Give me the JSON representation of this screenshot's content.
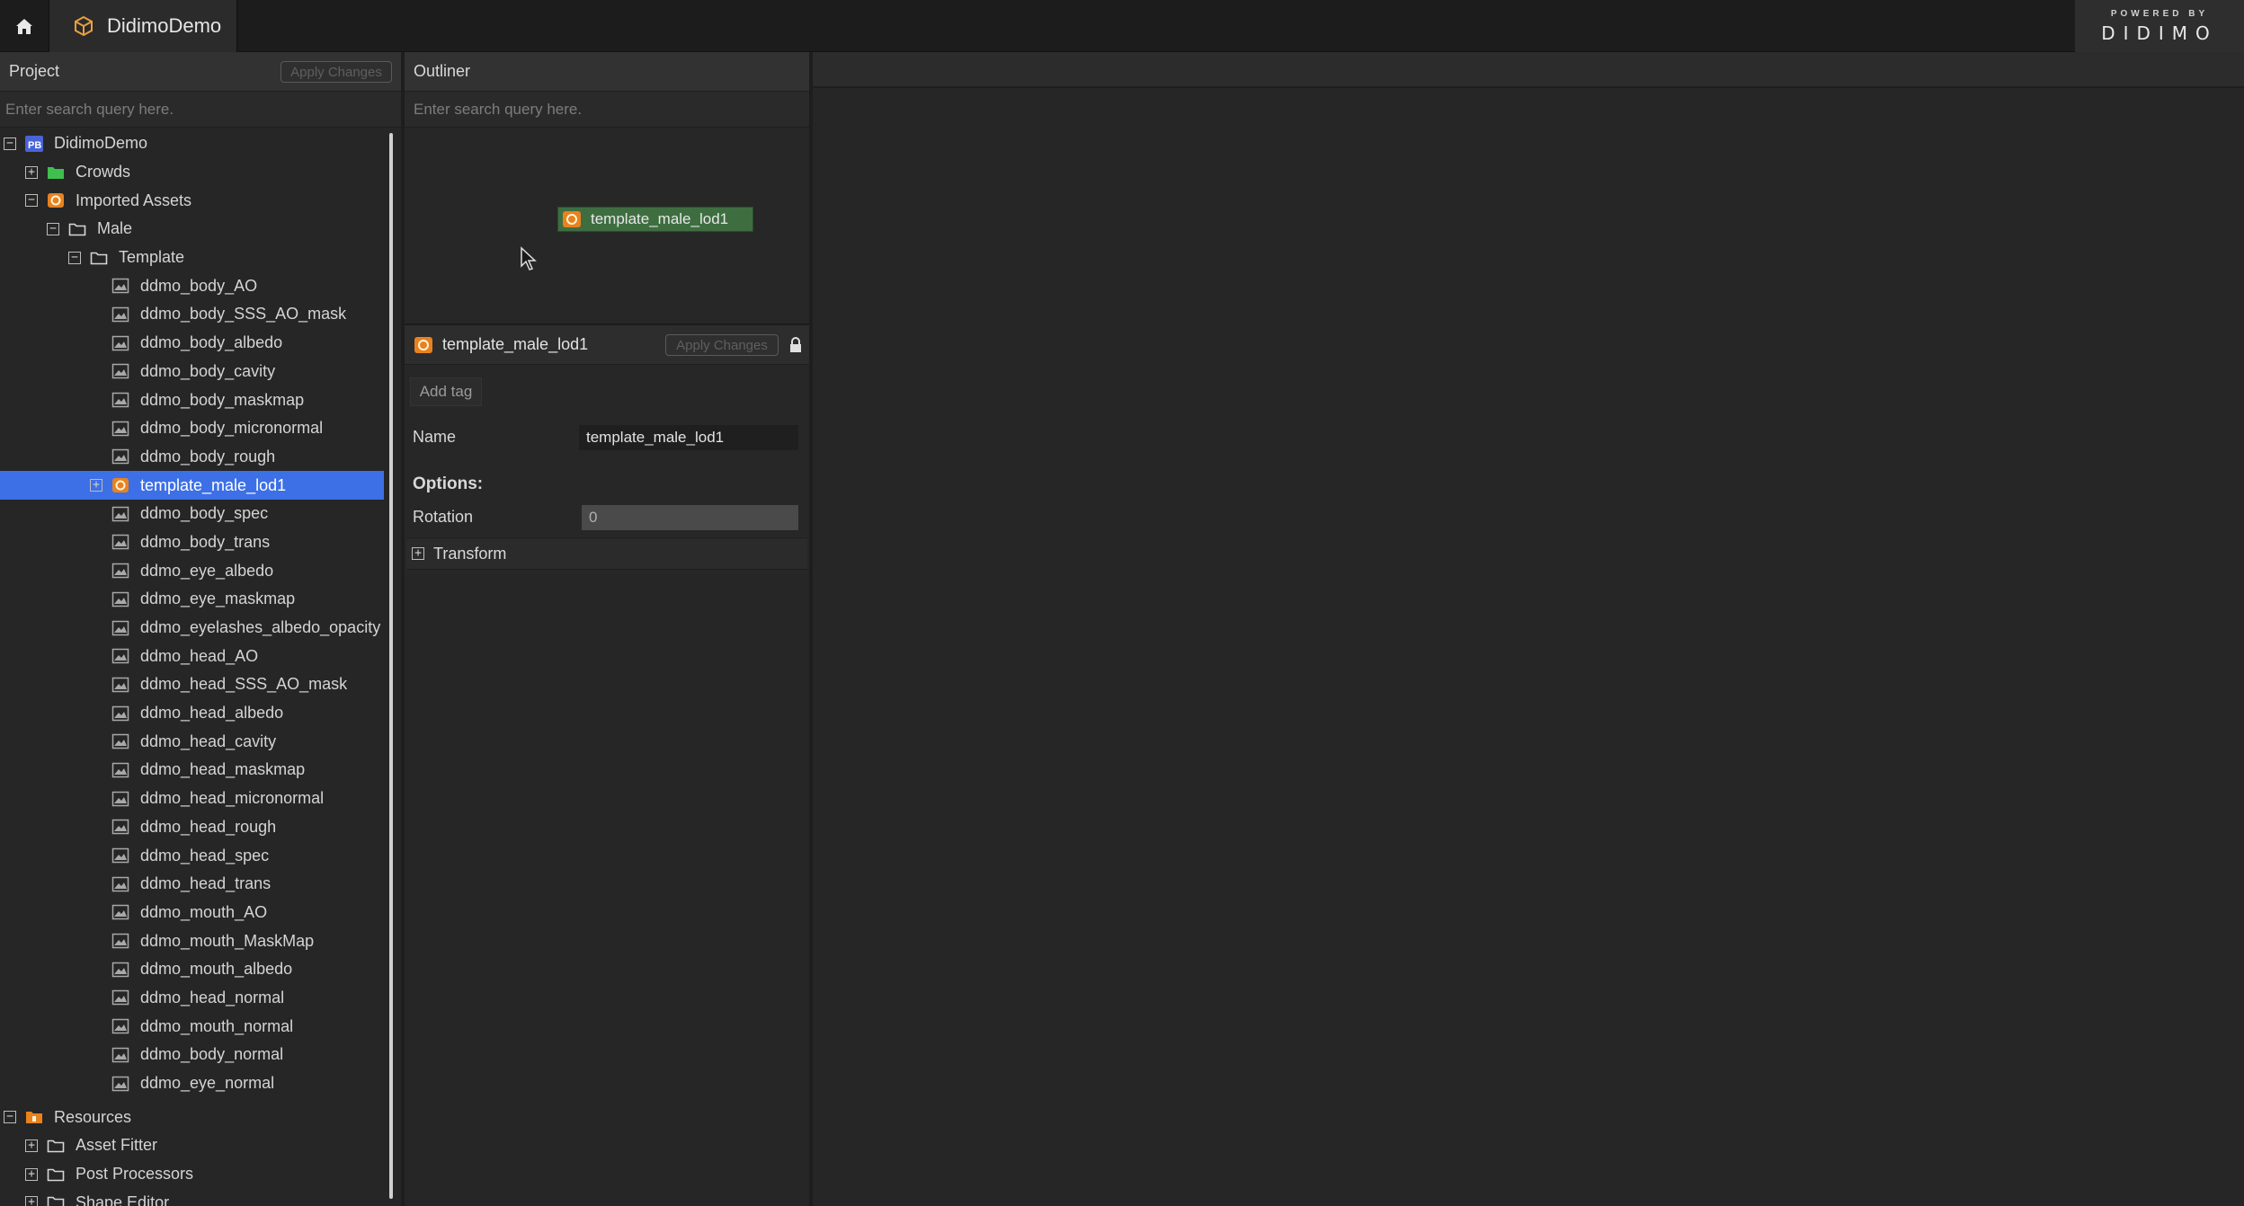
{
  "topbar": {
    "tab_title": "DidimoDemo",
    "brand_powered": "POWERED BY",
    "brand_logo": "DIDIMO"
  },
  "project": {
    "title": "Project",
    "apply_label": "Apply Changes",
    "search_placeholder": "Enter search query here.",
    "tree": [
      {
        "label": "DidimoDemo",
        "level": 0,
        "toggle": "minus",
        "icon": "project-icon"
      },
      {
        "label": "Crowds",
        "level": 1,
        "toggle": "plus",
        "icon": "green-folder-icon"
      },
      {
        "label": "Imported Assets",
        "level": 1,
        "toggle": "minus",
        "icon": "orange-asset-icon"
      },
      {
        "label": "Male",
        "level": 2,
        "toggle": "minus",
        "icon": "folder-icon"
      },
      {
        "label": "Template",
        "level": 3,
        "toggle": "minus",
        "icon": "folder-icon"
      },
      {
        "label": "ddmo_body_AO",
        "level": 4,
        "toggle": "none",
        "icon": "texture-icon"
      },
      {
        "label": "ddmo_body_SSS_AO_mask",
        "level": 4,
        "toggle": "none",
        "icon": "texture-icon"
      },
      {
        "label": "ddmo_body_albedo",
        "level": 4,
        "toggle": "none",
        "icon": "texture-icon"
      },
      {
        "label": "ddmo_body_cavity",
        "level": 4,
        "toggle": "none",
        "icon": "texture-icon"
      },
      {
        "label": "ddmo_body_maskmap",
        "level": 4,
        "toggle": "none",
        "icon": "texture-icon"
      },
      {
        "label": "ddmo_body_micronormal",
        "level": 4,
        "toggle": "none",
        "icon": "texture-icon"
      },
      {
        "label": "ddmo_body_rough",
        "level": 4,
        "toggle": "none",
        "icon": "texture-icon"
      },
      {
        "label": "template_male_lod1",
        "level": 4,
        "toggle": "plus",
        "icon": "orange-asset-icon",
        "selected": true
      },
      {
        "label": "ddmo_body_spec",
        "level": 4,
        "toggle": "none",
        "icon": "texture-icon"
      },
      {
        "label": "ddmo_body_trans",
        "level": 4,
        "toggle": "none",
        "icon": "texture-icon"
      },
      {
        "label": "ddmo_eye_albedo",
        "level": 4,
        "toggle": "none",
        "icon": "texture-icon"
      },
      {
        "label": "ddmo_eye_maskmap",
        "level": 4,
        "toggle": "none",
        "icon": "texture-icon"
      },
      {
        "label": "ddmo_eyelashes_albedo_opacity",
        "level": 4,
        "toggle": "none",
        "icon": "texture-icon"
      },
      {
        "label": "ddmo_head_AO",
        "level": 4,
        "toggle": "none",
        "icon": "texture-icon"
      },
      {
        "label": "ddmo_head_SSS_AO_mask",
        "level": 4,
        "toggle": "none",
        "icon": "texture-icon"
      },
      {
        "label": "ddmo_head_albedo",
        "level": 4,
        "toggle": "none",
        "icon": "texture-icon"
      },
      {
        "label": "ddmo_head_cavity",
        "level": 4,
        "toggle": "none",
        "icon": "texture-icon"
      },
      {
        "label": "ddmo_head_maskmap",
        "level": 4,
        "toggle": "none",
        "icon": "texture-icon"
      },
      {
        "label": "ddmo_head_micronormal",
        "level": 4,
        "toggle": "none",
        "icon": "texture-icon"
      },
      {
        "label": "ddmo_head_rough",
        "level": 4,
        "toggle": "none",
        "icon": "texture-icon"
      },
      {
        "label": "ddmo_head_spec",
        "level": 4,
        "toggle": "none",
        "icon": "texture-icon"
      },
      {
        "label": "ddmo_head_trans",
        "level": 4,
        "toggle": "none",
        "icon": "texture-icon"
      },
      {
        "label": "ddmo_mouth_AO",
        "level": 4,
        "toggle": "none",
        "icon": "texture-icon"
      },
      {
        "label": "ddmo_mouth_MaskMap",
        "level": 4,
        "toggle": "none",
        "icon": "texture-icon"
      },
      {
        "label": "ddmo_mouth_albedo",
        "level": 4,
        "toggle": "none",
        "icon": "texture-icon"
      },
      {
        "label": "ddmo_head_normal",
        "level": 4,
        "toggle": "none",
        "icon": "texture-icon"
      },
      {
        "label": "ddmo_mouth_normal",
        "level": 4,
        "toggle": "none",
        "icon": "texture-icon"
      },
      {
        "label": "ddmo_body_normal",
        "level": 4,
        "toggle": "none",
        "icon": "texture-icon"
      },
      {
        "label": "ddmo_eye_normal",
        "level": 4,
        "toggle": "none",
        "icon": "texture-icon"
      },
      {
        "label": "Resources",
        "level": 0,
        "toggle": "minus",
        "icon": "orange-folder-icon",
        "gap": true
      },
      {
        "label": "Asset Fitter",
        "level": 1,
        "toggle": "plus",
        "icon": "folder-icon"
      },
      {
        "label": "Post Processors",
        "level": 1,
        "toggle": "plus",
        "icon": "folder-icon"
      },
      {
        "label": "Shape Editor",
        "level": 1,
        "toggle": "plus",
        "icon": "folder-icon"
      }
    ]
  },
  "outliner": {
    "title": "Outliner",
    "search_placeholder": "Enter search query here.",
    "node_label": "template_male_lod1"
  },
  "inspector": {
    "title": "template_male_lod1",
    "apply_label": "Apply Changes",
    "add_tag_label": "Add tag",
    "name_label": "Name",
    "name_value": "template_male_lod1",
    "options_label": "Options:",
    "rotation_label": "Rotation",
    "rotation_value": "0",
    "transform_label": "Transform"
  },
  "colors": {
    "selection": "#3d6fe6",
    "node_green": "#3e6e40",
    "asset_orange": "#e8821e",
    "folder_green": "#3fbf4f",
    "project_icon": "#4a63d8"
  }
}
